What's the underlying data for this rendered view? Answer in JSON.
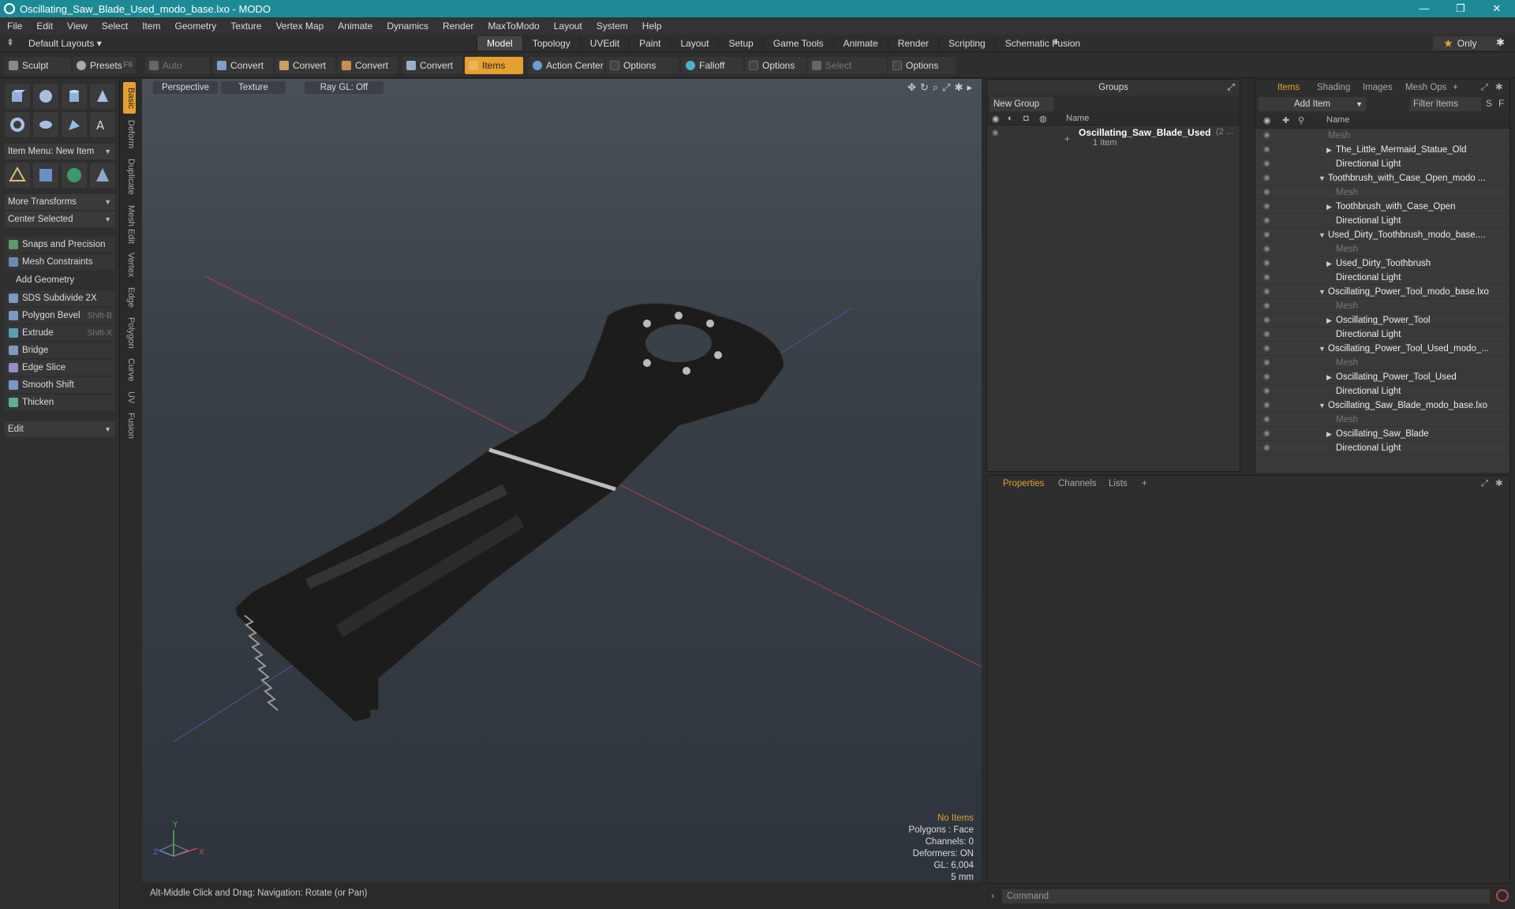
{
  "title": "Oscillating_Saw_Blade_Used_modo_base.lxo - MODO",
  "window_buttons": [
    "—",
    "❐",
    "✕"
  ],
  "menu": [
    "File",
    "Edit",
    "View",
    "Select",
    "Item",
    "Geometry",
    "Texture",
    "Vertex Map",
    "Animate",
    "Dynamics",
    "Render",
    "MaxToModo",
    "Layout",
    "System",
    "Help"
  ],
  "layout": {
    "default_layouts": "Default Layouts ▾",
    "tabs": [
      "Model",
      "Topology",
      "UVEdit",
      "Paint",
      "Layout",
      "Setup",
      "Game Tools",
      "Animate",
      "Render",
      "Scripting",
      "Schematic Fusion"
    ],
    "active_tab": "Model",
    "only": "Only"
  },
  "toolbar": {
    "sculpt": "Sculpt",
    "presets": "Presets",
    "presets_key": "F6",
    "auto_select": "Auto Select",
    "convert1": "Convert",
    "convert2": "Convert",
    "convert3": "Convert",
    "convert4": "Convert",
    "items": "Items",
    "action_center": "Action Center",
    "options1": "Options",
    "falloff": "Falloff",
    "options2": "Options",
    "select_through": "Select Through",
    "options3": "Options"
  },
  "left": {
    "item_menu": "Item Menu: New Item",
    "more_transforms": "More Transforms",
    "center_selected": "Center Selected",
    "snaps": "Snaps and Precision",
    "mesh_constraints": "Mesh Constraints",
    "add_geometry": "Add Geometry",
    "tools": [
      {
        "label": "SDS Subdivide 2X",
        "key": ""
      },
      {
        "label": "Polygon Bevel",
        "key": "Shift-B"
      },
      {
        "label": "Extrude",
        "key": "Shift-X"
      },
      {
        "label": "Bridge",
        "key": ""
      },
      {
        "label": "Edge Slice",
        "key": ""
      },
      {
        "label": "Smooth Shift",
        "key": ""
      },
      {
        "label": "Thicken",
        "key": ""
      }
    ],
    "edit": "Edit",
    "vtabs": [
      "Basic",
      "Deform",
      "Duplicate",
      "Mesh Edit",
      "Vertex",
      "Edge",
      "Polygon",
      "Curve",
      "UV",
      "Fusion"
    ]
  },
  "viewport": {
    "perspective": "Perspective",
    "texture": "Texture",
    "raygl": "Ray GL: Off",
    "info": {
      "no_items": "No Items",
      "polygons": "Polygons : Face",
      "channels": "Channels: 0",
      "deformers": "Deformers: ON",
      "gl": "GL: 6,004",
      "scale": "5 mm"
    },
    "axes": {
      "x": "X",
      "y": "Y",
      "z": "Z"
    }
  },
  "status": "Alt-Middle Click and Drag:   Navigation: Rotate (or Pan)",
  "groups": {
    "title": "Groups",
    "new_group": "New Group",
    "name_col": "Name",
    "row_name": "Oscillating_Saw_Blade_Used",
    "row_suffix": "(2 ...",
    "row_sub": "1 Item"
  },
  "items": {
    "tabs": [
      "Items",
      "Shading",
      "Images",
      "Mesh Ops"
    ],
    "add_item": "Add Item",
    "filter": "Filter Items",
    "s_btn": "S",
    "f_btn": "F",
    "name_col": "Name",
    "rows": [
      {
        "label": "Mesh",
        "indent": 92,
        "dim": true,
        "arrow": ""
      },
      {
        "label": "The_Little_Mermaid_Statue_Old",
        "indent": 102,
        "dim": false,
        "arrow": "▶"
      },
      {
        "label": "Directional Light",
        "indent": 102,
        "dim": false,
        "arrow": ""
      },
      {
        "label": "Toothbrush_with_Case_Open_modo ...",
        "indent": 92,
        "dim": false,
        "arrow": "▼"
      },
      {
        "label": "Mesh",
        "indent": 102,
        "dim": true,
        "arrow": ""
      },
      {
        "label": "Toothbrush_with_Case_Open",
        "indent": 102,
        "dim": false,
        "arrow": "▶"
      },
      {
        "label": "Directional Light",
        "indent": 102,
        "dim": false,
        "arrow": ""
      },
      {
        "label": "Used_Dirty_Toothbrush_modo_base....",
        "indent": 92,
        "dim": false,
        "arrow": "▼"
      },
      {
        "label": "Mesh",
        "indent": 102,
        "dim": true,
        "arrow": ""
      },
      {
        "label": "Used_Dirty_Toothbrush",
        "indent": 102,
        "dim": false,
        "arrow": "▶"
      },
      {
        "label": "Directional Light",
        "indent": 102,
        "dim": false,
        "arrow": ""
      },
      {
        "label": "Oscillating_Power_Tool_modo_base.lxo",
        "indent": 92,
        "dim": false,
        "arrow": "▼"
      },
      {
        "label": "Mesh",
        "indent": 102,
        "dim": true,
        "arrow": ""
      },
      {
        "label": "Oscillating_Power_Tool",
        "indent": 102,
        "dim": false,
        "arrow": "▶"
      },
      {
        "label": "Directional Light",
        "indent": 102,
        "dim": false,
        "arrow": ""
      },
      {
        "label": "Oscillating_Power_Tool_Used_modo_...",
        "indent": 92,
        "dim": false,
        "arrow": "▼"
      },
      {
        "label": "Mesh",
        "indent": 102,
        "dim": true,
        "arrow": ""
      },
      {
        "label": "Oscillating_Power_Tool_Used",
        "indent": 102,
        "dim": false,
        "arrow": "▶"
      },
      {
        "label": "Directional Light",
        "indent": 102,
        "dim": false,
        "arrow": ""
      },
      {
        "label": "Oscillating_Saw_Blade_modo_base.lxo",
        "indent": 92,
        "dim": false,
        "arrow": "▼"
      },
      {
        "label": "Mesh",
        "indent": 102,
        "dim": true,
        "arrow": ""
      },
      {
        "label": "Oscillating_Saw_Blade",
        "indent": 102,
        "dim": false,
        "arrow": "▶"
      },
      {
        "label": "Directional Light",
        "indent": 102,
        "dim": false,
        "arrow": ""
      }
    ]
  },
  "props": {
    "tabs": [
      "Properties",
      "Channels",
      "Lists"
    ],
    "plus": "+"
  },
  "command": "Command",
  "colors": {
    "accent": "#e6a030",
    "titlebar": "#1d8a96"
  }
}
